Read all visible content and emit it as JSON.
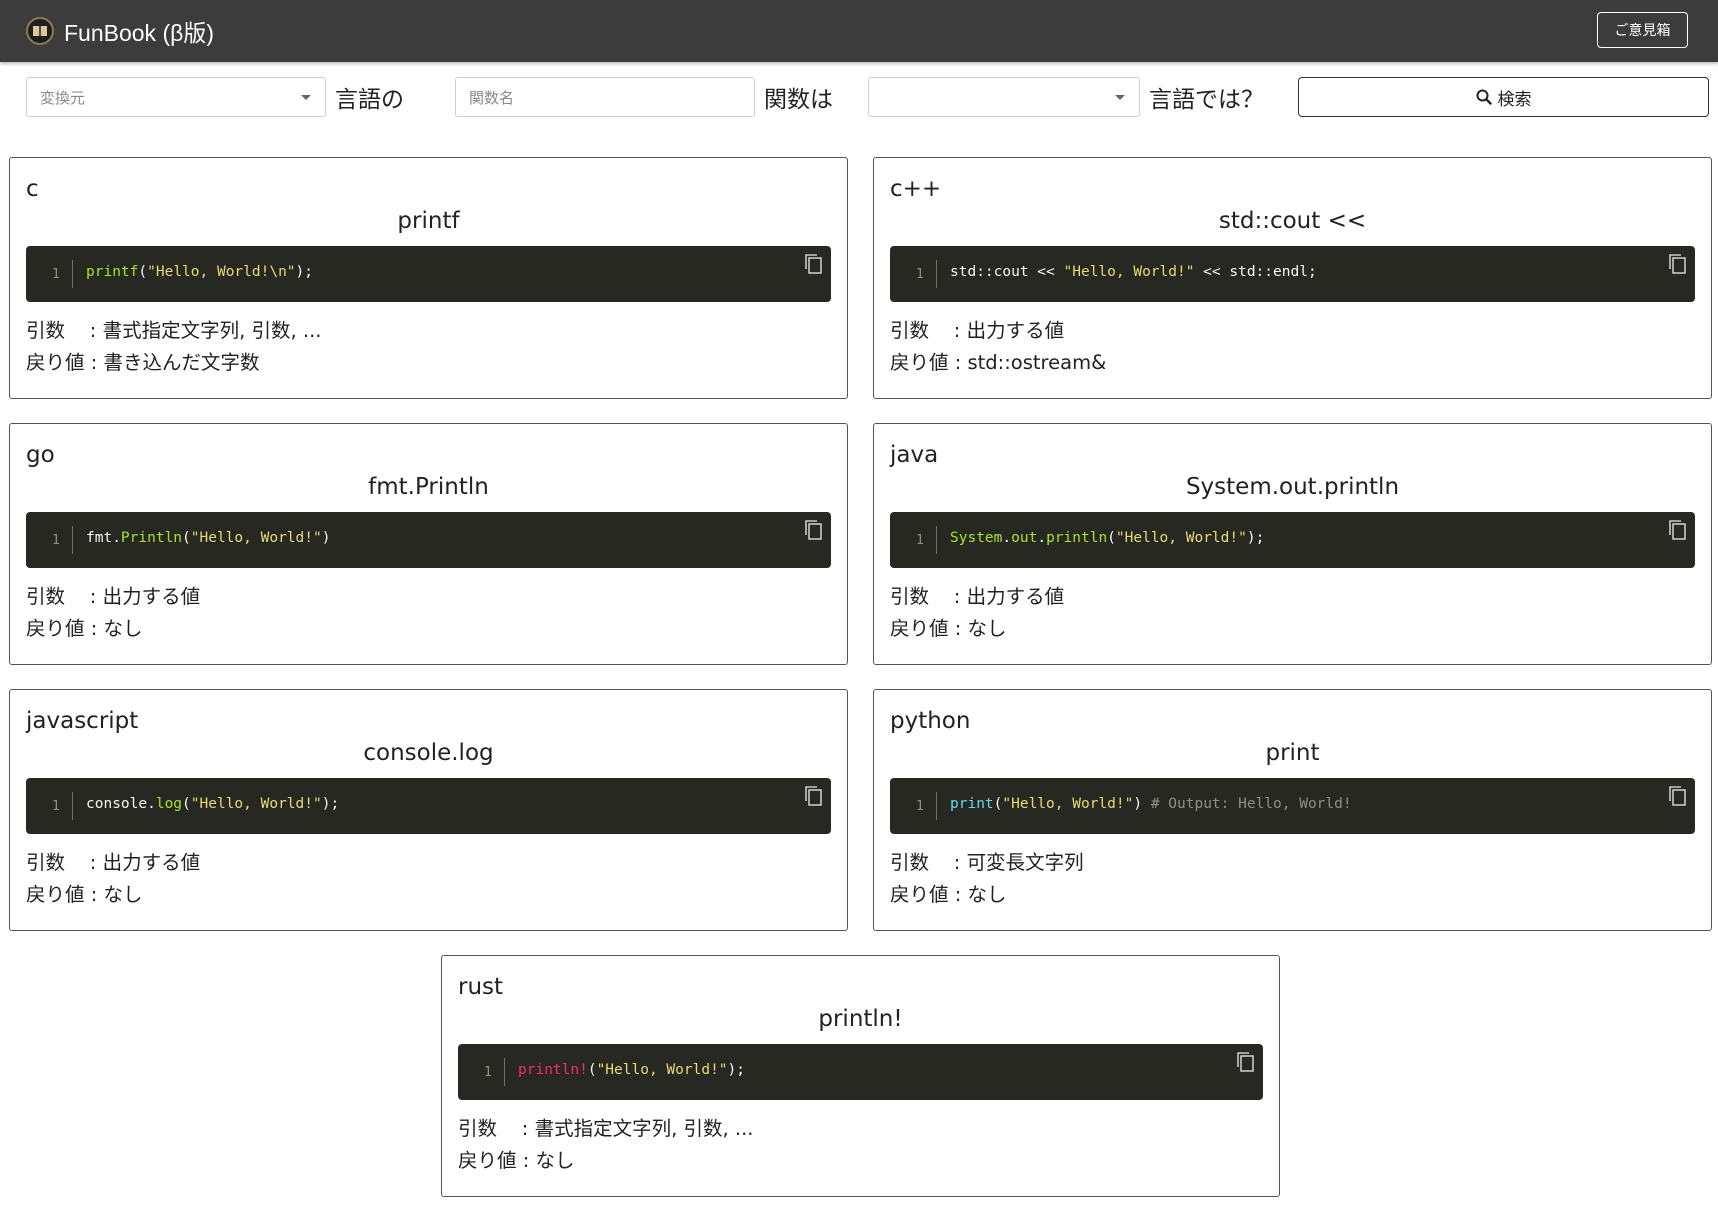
{
  "app": {
    "title": "FunBook (β版)",
    "feedback_label": "ご意見箱"
  },
  "search": {
    "source_placeholder": "変換元",
    "phrase_lang": "言語の",
    "function_placeholder": "関数名",
    "phrase_func": "関数は",
    "target_value": "",
    "phrase_target": "言語では？",
    "button_label": "検索"
  },
  "labels": {
    "args": "引数",
    "ret": "戻り値"
  },
  "colors": {
    "topbar": "#3c3c3c",
    "code_bg": "#272822",
    "func": "#a6e22e",
    "string": "#e6db74",
    "builtin": "#66d9ef",
    "macro": "#f92672",
    "comment": "#8d8f8a"
  },
  "cards": [
    {
      "lang": "c",
      "func": "printf",
      "line": "1",
      "code": [
        {
          "t": "printf",
          "c": "fn"
        },
        {
          "t": "("
        },
        {
          "t": "\"Hello, World!\\n\"",
          "c": "str"
        },
        {
          "t": ");"
        }
      ],
      "args": "書式指定文字列, 引数, ...",
      "ret": "書き込んだ文字数"
    },
    {
      "lang": "c++",
      "func": "std::cout <<",
      "line": "1",
      "code": [
        {
          "t": "std::cout << "
        },
        {
          "t": "\"Hello, World!\"",
          "c": "str"
        },
        {
          "t": " << std::endl;"
        }
      ],
      "args": "出力する値",
      "ret": "std::ostream&"
    },
    {
      "lang": "go",
      "func": "fmt.Println",
      "line": "1",
      "code": [
        {
          "t": "fmt."
        },
        {
          "t": "Println",
          "c": "fn"
        },
        {
          "t": "("
        },
        {
          "t": "\"Hello, World!\"",
          "c": "str"
        },
        {
          "t": ")"
        }
      ],
      "args": "出力する値",
      "ret": "なし"
    },
    {
      "lang": "java",
      "func": "System.out.println",
      "line": "1",
      "code": [
        {
          "t": "System",
          "c": "fn"
        },
        {
          "t": "."
        },
        {
          "t": "out",
          "c": "fn"
        },
        {
          "t": "."
        },
        {
          "t": "println",
          "c": "fn"
        },
        {
          "t": "("
        },
        {
          "t": "\"Hello, World!\"",
          "c": "str"
        },
        {
          "t": ");"
        }
      ],
      "args": "出力する値",
      "ret": "なし"
    },
    {
      "lang": "javascript",
      "func": "console.log",
      "line": "1",
      "code": [
        {
          "t": "console."
        },
        {
          "t": "log",
          "c": "fn"
        },
        {
          "t": "("
        },
        {
          "t": "\"Hello, World!\"",
          "c": "str"
        },
        {
          "t": ");"
        }
      ],
      "args": "出力する値",
      "ret": "なし"
    },
    {
      "lang": "python",
      "func": "print",
      "line": "1",
      "code": [
        {
          "t": "print",
          "c": "builtin"
        },
        {
          "t": "("
        },
        {
          "t": "\"Hello, World!\"",
          "c": "str"
        },
        {
          "t": ") "
        },
        {
          "t": "# Output: Hello, World!",
          "c": "cmt"
        }
      ],
      "args": "可変長文字列",
      "ret": "なし"
    },
    {
      "lang": "rust",
      "func": "println!",
      "line": "1",
      "code": [
        {
          "t": "println!",
          "c": "macro"
        },
        {
          "t": "("
        },
        {
          "t": "\"Hello, World!\"",
          "c": "str"
        },
        {
          "t": ");"
        }
      ],
      "args": "書式指定文字列, 引数, ...",
      "ret": "なし"
    }
  ]
}
